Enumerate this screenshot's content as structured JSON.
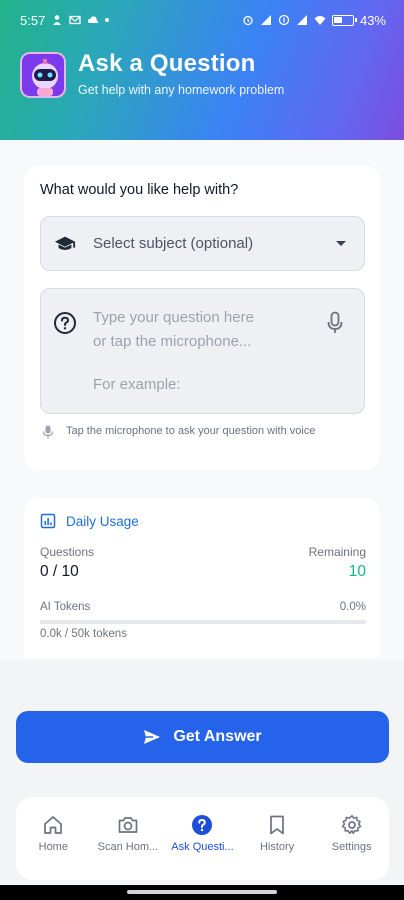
{
  "status": {
    "time": "5:57",
    "battery": "43%"
  },
  "header": {
    "title": "Ask a Question",
    "subtitle": "Get help with any homework problem"
  },
  "question_card": {
    "prompt_label": "What would you like help with?",
    "subject_select": {
      "value": "Select subject (optional)"
    },
    "question_input": {
      "placeholder_lines": [
        "Type your question here",
        "or tap the microphone..."
      ],
      "example_label": "For example:"
    },
    "voice_hint": "Tap the microphone to ask your question with voice"
  },
  "usage_card": {
    "title": "Daily Usage",
    "questions_label": "Questions",
    "questions_value": "0 / 10",
    "remaining_label": "Remaining",
    "remaining_value": "10",
    "tokens_label": "AI Tokens",
    "tokens_percent": "0.0%",
    "tokens_fraction": 0.0,
    "tokens_count": "0.0k / 50k tokens"
  },
  "action": {
    "get_answer_label": "Get Answer"
  },
  "tabs": [
    {
      "label": "Home",
      "icon": "home-icon",
      "active": false
    },
    {
      "label": "Scan Hom...",
      "icon": "camera-icon",
      "active": false
    },
    {
      "label": "Ask Questi...",
      "icon": "help-circle-icon",
      "active": true
    },
    {
      "label": "History",
      "icon": "bookmark-icon",
      "active": false
    },
    {
      "label": "Settings",
      "icon": "gear-icon",
      "active": false
    }
  ],
  "colors": {
    "primary": "#2563eb",
    "active_tab": "#1d4ed8",
    "remaining": "#10b981",
    "usage_title": "#1d6fd6"
  }
}
